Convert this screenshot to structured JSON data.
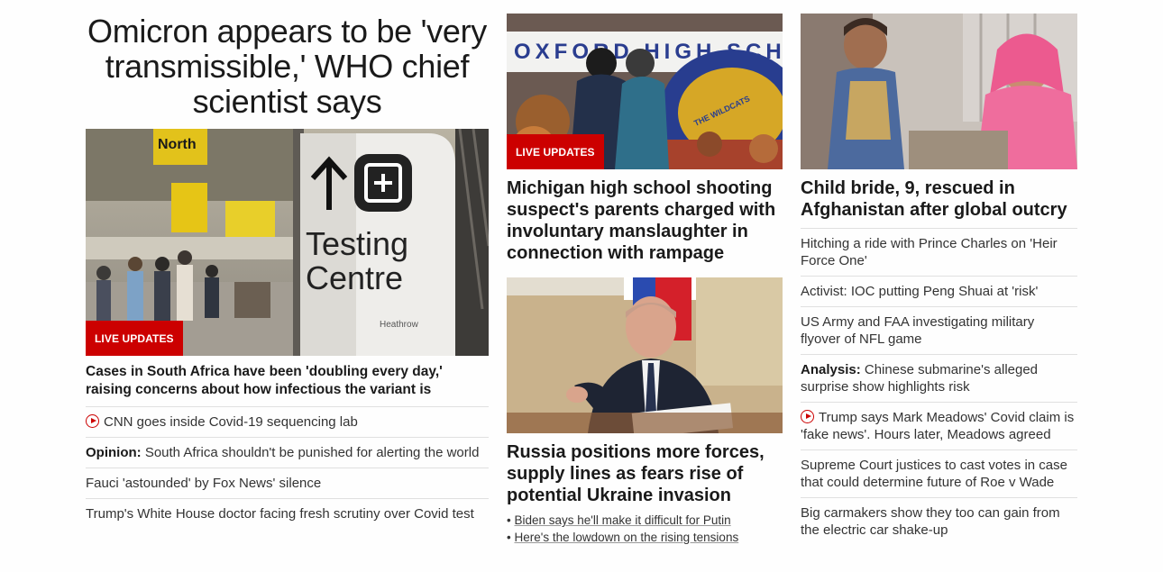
{
  "col1": {
    "top_headline": "Omicron appears to be 'very transmissible,' WHO chief scientist says",
    "image": {
      "sign_north": "North",
      "sign_testing": "Testing",
      "sign_centre": "Centre",
      "sign_brand": "Heathrow"
    },
    "badge": "LIVE UPDATES",
    "headline": "Cases in South Africa have been 'doubling every day,' raising concerns about how infectious the variant is",
    "items": [
      {
        "text": "CNN goes inside Covid-19 sequencing lab",
        "video": true
      },
      {
        "kicker": "Opinion:",
        "text": " South Africa shouldn't be punished for alerting the world"
      },
      {
        "text": "Fauci 'astounded' by Fox News' silence"
      },
      {
        "text": "Trump's White House doctor facing fresh scrutiny over Covid test"
      }
    ]
  },
  "col2": {
    "story1": {
      "image": {
        "sign_text": "OXFORD HIGH SCH",
        "sign_sub": "THE WILDCATS"
      },
      "badge": "LIVE UPDATES",
      "headline": "Michigan high school shooting suspect's parents charged with involuntary manslaughter in connection with rampage"
    },
    "story2": {
      "headline": "Russia positions more forces, supply lines as fears rise of potential Ukraine invasion",
      "bullets": [
        "Biden says he'll make it difficult for Putin",
        "Here's the lowdown on the rising tensions"
      ]
    }
  },
  "col3": {
    "headline": "Child bride, 9, rescued in Afghanistan after global outcry",
    "items": [
      {
        "text": "Hitching a ride with Prince Charles on 'Heir Force One'"
      },
      {
        "text": "Activist: IOC putting Peng Shuai at 'risk'"
      },
      {
        "text": "US Army and FAA investigating military flyover of NFL game"
      },
      {
        "kicker": "Analysis:",
        "text": " Chinese submarine's alleged surprise show highlights risk"
      },
      {
        "text": "Trump says Mark Meadows' Covid claim is 'fake news'. Hours later, Meadows agreed",
        "video": true
      },
      {
        "text": "Supreme Court justices to cast votes in case that could determine future of Roe v Wade"
      },
      {
        "text": "Big carmakers show they too can gain from the electric car shake-up"
      }
    ]
  },
  "colors": {
    "accent": "#cc0000",
    "text": "#262626",
    "divider": "#e0e0e0"
  }
}
